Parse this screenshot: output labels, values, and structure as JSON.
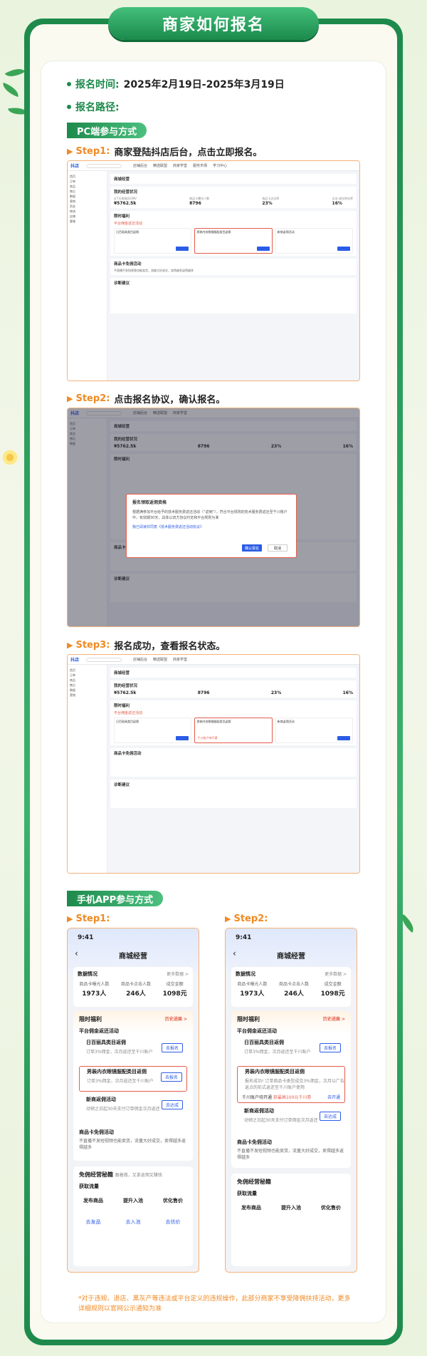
{
  "page": {
    "title": "商家如何报名",
    "time_label": "报名时间:",
    "time_value": "2025年2月19日-2025年3月19日",
    "path_label": "报名路径:"
  },
  "pc": {
    "section_title": "PC端参与方式",
    "steps": [
      {
        "num": "Step1:",
        "text": "商家登陆抖店后台，点击立即报名。"
      },
      {
        "num": "Step2:",
        "text": "点击报名协议，确认报名。"
      },
      {
        "num": "Step3:",
        "text": "报名成功，查看报名状态。"
      }
    ],
    "dashboard": {
      "logo": "抖店",
      "search_placeholder": "搜索功能",
      "top_menu": [
        "店铺后台",
        "精选联盟",
        "商家学堂",
        "服务市场",
        "学习中心"
      ],
      "page_title": "商城经营",
      "overview_title": "我的经营状况",
      "stats": [
        {
          "label": "近7天商城总GMV",
          "value": "¥5762.5k"
        },
        {
          "label": "商品卡曝光人数",
          "value": "8796"
        },
        {
          "label": "商品卡点击率",
          "value": "23%"
        },
        {
          "label": "点击-成交转化率",
          "value": "16%"
        }
      ],
      "benefit_title": "限时福利",
      "activity_title": "平台佣金返还活动",
      "activities": [
        {
          "title": "日百丽具类目返佣"
        },
        {
          "title": "男装内衣眼镜服配类目返佣"
        },
        {
          "title": "新商返佣活动"
        }
      ],
      "free_title": "商品卡免佣活动",
      "free_desc": "不直播不发短视频也能卖货，流量大好成交，卖得越多返得越多",
      "diag_title": "诊断建议",
      "sidebar": [
        "首页",
        "订单",
        "商品",
        "售后",
        "数据",
        "营销",
        "资金",
        "物流",
        "店铺",
        "客服"
      ]
    },
    "modal": {
      "title": "报名领取返佣资格",
      "body": "根据满参加平台给予的技术服务费返还活动（“返佣”），符合平台规则的技术服务费返还至千川账户中，有效期30天，具体以双方协议约定和平台规则为准",
      "agreement": "我已阅读并同意《技术服务费返还活动协议》",
      "confirm": "确认报名",
      "cancel": "取消"
    },
    "status_text": "千川账户待开通"
  },
  "app": {
    "section_title": "手机APP参与方式",
    "steps": [
      {
        "num": "Step1:"
      },
      {
        "num": "Step2:"
      }
    ],
    "time": "9:41",
    "page_title": "商城经营",
    "data_title": "数据情况",
    "data_range": "统计时间 2022.12.01-2022.12.30",
    "more_data": "更多数据 >",
    "stats": [
      {
        "label": "商品卡曝光人数",
        "value": "1973人"
      },
      {
        "label": "商品卡点击人数",
        "value": "246人"
      },
      {
        "label": "成交金额",
        "value": "1098元"
      }
    ],
    "benefit_title": "限时福利",
    "history_link": "历史进展 >",
    "activity_title": "平台佣金返还活动",
    "rules": "规则",
    "items": [
      {
        "name": "日百丽具类目返佣",
        "desc": "订单3%佣金，次月返还至千川账户",
        "btn": "去报名"
      },
      {
        "name": "男装内衣眼镜服配类目返佣",
        "desc": "订单3%佣金，次月返还至千川账户",
        "btn": "去报名"
      },
      {
        "name": "新商返佣活动",
        "desc": "动销之日起30天支付订单佣金次月返还",
        "btn": "去达成"
      }
    ],
    "step2_item_desc": "报名成功! 订单商品卡类型成交3%佣金，次月以广告返点的形式返还至千川账户使用",
    "step2_status": "千川账户待开通",
    "step2_status_extra": "获最高100元千川券",
    "step2_status_link": "去开通",
    "free_title": "商品卡免佣活动",
    "free_tags": [
      "仅限流量",
      "免佣金",
      "新机遇"
    ],
    "free_desc": "不直播不发短视频也能卖货，流量大好成交，卖得越多返得越多",
    "secret_title": "免佣经营秘籍",
    "secret_sub": "跟着做，又拿返佣又赚钱",
    "flow_title": "获取流量",
    "flow_items": [
      {
        "name": "发布商品",
        "action": "去发品"
      },
      {
        "name": "提升入池",
        "action": "去入池"
      },
      {
        "name": "优化售价",
        "action": "去优价"
      }
    ]
  },
  "footer_note": "*对于违规、退店、黑灰产等违法或平台定义的违规操作，此部分商家不享受降佣扶持活动，更多详细规则以官网公示通知为准"
}
